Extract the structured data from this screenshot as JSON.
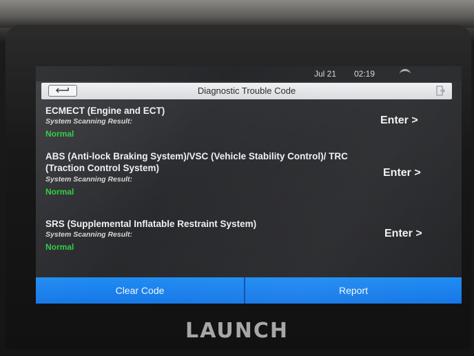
{
  "status_bar": {
    "date": "Jul 21",
    "time": "02:19"
  },
  "header": {
    "title": "Diagnostic Trouble Code"
  },
  "systems": [
    {
      "title": "ECMECT (Engine and ECT)",
      "result_label": "System Scanning Result:",
      "result": "Normal",
      "enter_label": "Enter >"
    },
    {
      "title": "ABS (Anti-lock Braking System)/VSC (Vehicle Stability Control)/ TRC (Traction Control System)",
      "result_label": "System Scanning Result:",
      "result": "Normal",
      "enter_label": "Enter >"
    },
    {
      "title": "SRS (Supplemental Inflatable Restraint System)",
      "result_label": "System Scanning Result:",
      "result": "Normal",
      "enter_label": "Enter >"
    }
  ],
  "actions": {
    "clear_code": "Clear Code",
    "report": "Report"
  },
  "brand": {
    "logo_text": "LAUNCH"
  },
  "colors": {
    "accent": "#1f8cf3",
    "status_ok": "#2ecc40"
  },
  "icons": {
    "back": "back-arrow-icon",
    "exit": "exit-icon",
    "wifi": "wifi-icon"
  }
}
